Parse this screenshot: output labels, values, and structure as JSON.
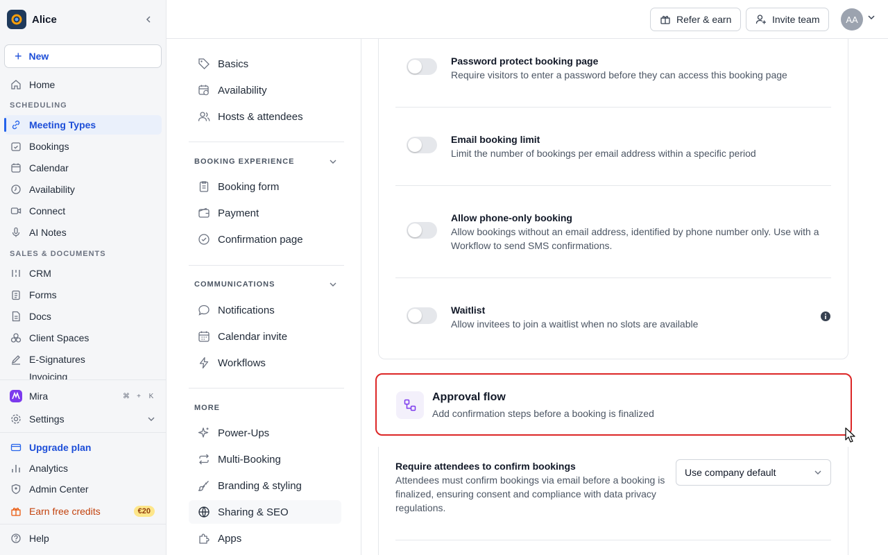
{
  "workspace": {
    "name": "Alice"
  },
  "sidebar": {
    "new_label": "New",
    "home": "Home",
    "section_scheduling": "SCHEDULING",
    "scheduling_items": [
      "Meeting Types",
      "Bookings",
      "Calendar",
      "Availability",
      "Connect",
      "AI Notes"
    ],
    "section_sales": "SALES & DOCUMENTS",
    "sales_items": [
      "CRM",
      "Forms",
      "Docs",
      "Client Spaces",
      "E-Signatures",
      "Invoicing"
    ],
    "mira": "Mira",
    "mira_shortcut": [
      "⌘",
      "+",
      "K"
    ],
    "settings": "Settings",
    "upgrade": "Upgrade plan",
    "analytics": "Analytics",
    "admin": "Admin Center",
    "credits": "Earn free credits",
    "credits_badge": "€20",
    "help": "Help"
  },
  "topbar": {
    "refer": "Refer & earn",
    "invite": "Invite team",
    "avatar": "AA"
  },
  "subnav": {
    "top_items": [
      "Basics",
      "Availability",
      "Hosts & attendees"
    ],
    "section_booking": "BOOKING EXPERIENCE",
    "booking_items": [
      "Booking form",
      "Payment",
      "Confirmation page"
    ],
    "section_comms": "COMMUNICATIONS",
    "comms_items": [
      "Notifications",
      "Calendar invite",
      "Workflows"
    ],
    "section_more": "MORE",
    "more_items": [
      "Power-Ups",
      "Multi-Booking",
      "Branding & styling",
      "Sharing & SEO",
      "Apps"
    ]
  },
  "settings_list": [
    {
      "title": "Password protect booking page",
      "desc": "Require visitors to enter a password before they can access this booking page",
      "enabled": false
    },
    {
      "title": "Email booking limit",
      "desc": "Limit the number of bookings per email address within a specific period",
      "enabled": false
    },
    {
      "title": "Allow phone-only booking",
      "desc": "Allow bookings without an email address, identified by phone number only. Use with a Workflow to send SMS confirmations.",
      "enabled": false
    },
    {
      "title": "Waitlist",
      "desc": "Allow invitees to join a waitlist when no slots are available",
      "enabled": false
    }
  ],
  "approval": {
    "title": "Approval flow",
    "desc": "Add confirmation steps before a booking is finalized"
  },
  "require_confirm": {
    "title": "Require attendees to confirm bookings",
    "desc": "Attendees must confirm bookings via email before a booking is finalized, ensuring consent and compliance with data privacy regulations.",
    "select_value": "Use company default"
  },
  "colors": {
    "accent": "#2563eb",
    "highlight_border": "#dc2626",
    "credit_badge": "#fde68a"
  }
}
